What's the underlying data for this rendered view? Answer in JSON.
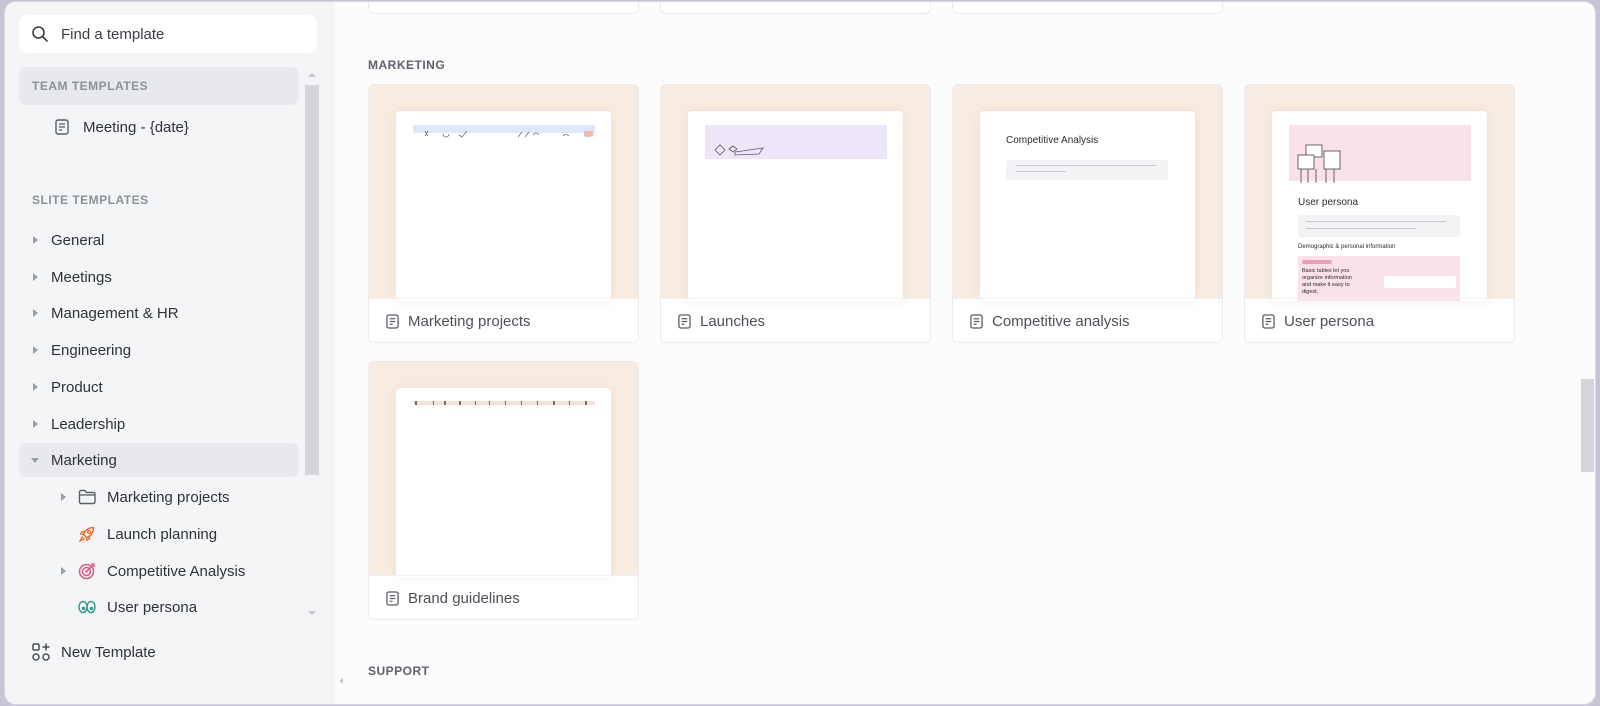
{
  "sidebar": {
    "search": {
      "placeholder": "Find a template",
      "icon": "search-icon"
    },
    "team_templates": {
      "header": "TEAM TEMPLATES",
      "items": [
        {
          "label": "Meeting - {date}",
          "icon": "document-icon"
        }
      ]
    },
    "slite_templates": {
      "header": "SLITE TEMPLATES",
      "categories": [
        {
          "label": "General",
          "expanded": false
        },
        {
          "label": "Meetings",
          "expanded": false
        },
        {
          "label": "Management & HR",
          "expanded": false
        },
        {
          "label": "Engineering",
          "expanded": false
        },
        {
          "label": "Product",
          "expanded": false
        },
        {
          "label": "Leadership",
          "expanded": false
        },
        {
          "label": "Marketing",
          "expanded": true,
          "selected": true
        }
      ],
      "marketing_children": [
        {
          "label": "Marketing projects",
          "icon": "folder-icon",
          "has_children": true
        },
        {
          "label": "Launch planning",
          "icon": "rocket-icon",
          "has_children": false
        },
        {
          "label": "Competitive Analysis",
          "icon": "target-icon",
          "has_children": true
        },
        {
          "label": "User persona",
          "icon": "eyes-icon",
          "has_children": false
        }
      ]
    },
    "new_template_label": "New Template"
  },
  "main": {
    "sections": [
      {
        "title": "MARKETING",
        "cards": [
          {
            "label": "Marketing projects",
            "icon": "document-icon"
          },
          {
            "label": "Launches",
            "icon": "document-icon"
          },
          {
            "label": "Competitive analysis",
            "icon": "document-icon",
            "preview_title": "Competitive Analysis"
          },
          {
            "label": "User persona",
            "icon": "document-icon",
            "preview_title": "User persona",
            "preview_subtitle": "Demographic & personal information",
            "preview_text": "Basic tables let you organize information and make it easy to digest,"
          },
          {
            "label": "Brand guidelines",
            "icon": "document-icon"
          }
        ]
      },
      {
        "title": "SUPPORT",
        "cards": []
      }
    ]
  },
  "colors": {
    "preview_bg": "#f8ece2",
    "sidebar_bg": "#f4f5f7",
    "selected_bg": "#e8e9ec",
    "rocket": "#e8692c",
    "target": "#e05a8a",
    "eyes": "#3a9a8a"
  }
}
